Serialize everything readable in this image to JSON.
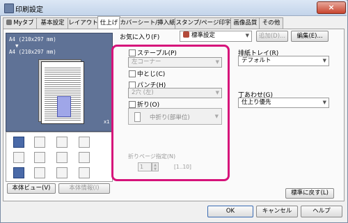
{
  "window": {
    "title": "印刷設定",
    "close_label": "×"
  },
  "tabs": [
    {
      "label": "Myタブ",
      "active": false
    },
    {
      "label": "基本設定",
      "active": false
    },
    {
      "label": "レイアウト",
      "active": false
    },
    {
      "label": "仕上げ",
      "active": true
    },
    {
      "label": "カバーシート/挿入紙",
      "active": false
    },
    {
      "label": "スタンプ/ページ印字",
      "active": false
    },
    {
      "label": "画像品質",
      "active": false
    },
    {
      "label": "その他",
      "active": false
    }
  ],
  "preview": {
    "text": "A4 (210x297 mm)\n  ▼\nA4 (210x297 mm)",
    "x_label": "x1"
  },
  "preview_buttons": {
    "printer_view": "本体ビュー(V)",
    "printer_info": "本体情報(I)"
  },
  "favorites": {
    "label": "お気に入り(F)",
    "value": "標準設定",
    "add": "追加(D)...",
    "edit": "編集(E)..."
  },
  "finishing": {
    "staple": {
      "label": "ステープル(P)",
      "value": "左コーナー",
      "checked": false
    },
    "center_staple": {
      "label": "中とじ(C)",
      "checked": false
    },
    "punch": {
      "label": "パンチ(H)",
      "value": "2穴 (左)",
      "checked": false
    },
    "fold": {
      "label": "折り(O)",
      "value": "中折り(部単位)",
      "checked": false
    },
    "fold_page": {
      "label": "折りページ指定(N)",
      "value": "1",
      "range": "[1..10]"
    }
  },
  "output_tray": {
    "label": "排紙トレイ(R)",
    "value": "デフォルト"
  },
  "collate": {
    "label": "丁あわせ(G)",
    "value": "仕上り優先"
  },
  "restore_defaults": "標準に戻す(L)",
  "footer": {
    "ok": "OK",
    "cancel": "キャンセル",
    "help": "ヘルプ"
  },
  "colors": {
    "highlight": "#d6137a",
    "preview_bg": "#5f7296"
  }
}
